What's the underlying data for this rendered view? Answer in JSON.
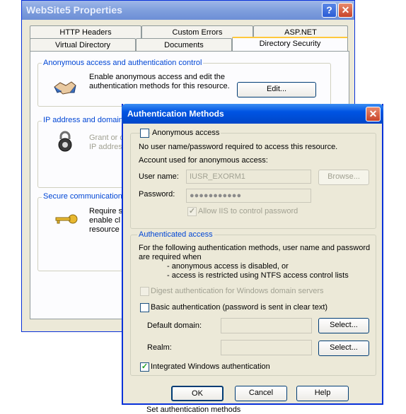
{
  "props_window": {
    "title": "WebSite5 Properties",
    "help_glyph": "?",
    "close_glyph": "✕",
    "tabs_back": [
      "HTTP Headers",
      "Custom Errors",
      "ASP.NET"
    ],
    "tabs_front": [
      "Virtual Directory",
      "Documents",
      "Directory Security"
    ],
    "active_tab": "Directory Security",
    "anon_group": {
      "title": "Anonymous access and authentication control",
      "desc_line1": "Enable anonymous access and edit the",
      "desc_line2": "authentication methods for this resource.",
      "edit_button": "Edit..."
    },
    "ip_group": {
      "title": "IP address and domain",
      "line1": "Grant or d",
      "line2": "IP addres"
    },
    "secure_group": {
      "title": "Secure communications",
      "line1": "Require s",
      "line2": "enable cl",
      "line3": "resource"
    }
  },
  "auth_dialog": {
    "title": "Authentication Methods",
    "close_glyph": "✕",
    "anonymous": {
      "checkbox_label": "Anonymous access",
      "checked": false,
      "note": "No user name/password required to access this resource.",
      "account_heading": "Account used for anonymous access:",
      "username_label": "User name:",
      "username_value": "IUSR_EXORM1",
      "browse_button": "Browse...",
      "password_label": "Password:",
      "password_value": "●●●●●●●●●●●",
      "allow_iis_label": "Allow IIS to control password",
      "allow_iis_checked": true
    },
    "authenticated": {
      "title": "Authenticated access",
      "desc_line1": "For the following authentication methods, user name and password",
      "desc_line2": "are required when",
      "bullet1": "- anonymous access is disabled, or",
      "bullet2": "- access is restricted using NTFS access control lists",
      "digest_label": "Digest authentication for Windows domain servers",
      "digest_checked": false,
      "basic_label": "Basic authentication (password is sent in clear text)",
      "basic_checked": false,
      "default_domain_label": "Default domain:",
      "default_domain_value": "",
      "realm_label": "Realm:",
      "realm_value": "",
      "select_button": "Select...",
      "integrated_label": "Integrated Windows authentication",
      "integrated_checked": true,
      "check_glyph": "✓"
    },
    "buttons": {
      "ok": "OK",
      "cancel": "Cancel",
      "help": "Help"
    }
  },
  "caption": "Set authentication methods"
}
